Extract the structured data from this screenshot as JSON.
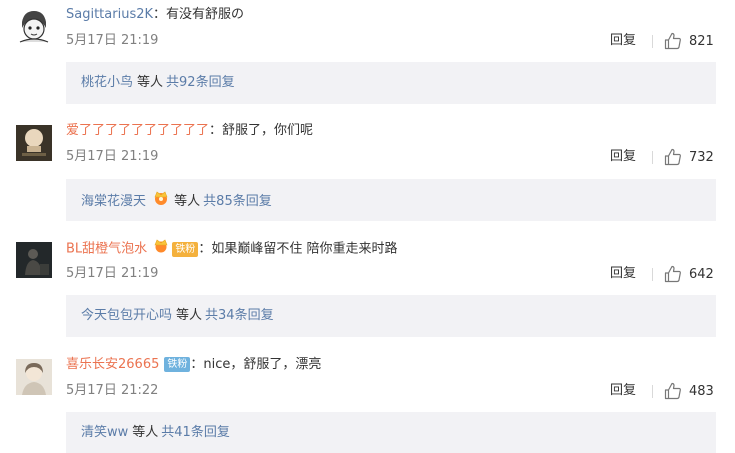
{
  "comments": [
    {
      "user": "Sagittarius2K",
      "colon": "：",
      "text": "有没有舒服の",
      "time": "5月17日 21:19",
      "reply_label": "回复",
      "likes": "821",
      "sub_name": "桃花小鸟",
      "sub_etc": "等人",
      "sub_total": "共92条回复"
    },
    {
      "user": "爱了了了了了了了了了了",
      "colon": "：",
      "text": "舒服了，你们呢",
      "time": "5月17日 21:19",
      "reply_label": "回复",
      "likes": "732",
      "sub_name": "海棠花漫天",
      "sub_etc": "等人",
      "sub_total": "共85条回复"
    },
    {
      "user": "BL甜橙气泡水",
      "fan_badge": "铁粉",
      "colon": "：",
      "text": "如果巅峰留不住 陪你重走来时路",
      "time": "5月17日 21:19",
      "reply_label": "回复",
      "likes": "642",
      "sub_name": "今天包包开心吗",
      "sub_etc": "等人",
      "sub_total": "共34条回复"
    },
    {
      "user": "喜乐长安26665",
      "fan_badge": "铁粉",
      "colon": "：",
      "text": "nice，舒服了，漂亮",
      "time": "5月17日 21:22",
      "reply_label": "回复",
      "likes": "483",
      "sub_name": "清笑ww",
      "sub_etc": "等人",
      "sub_total": "共41条回复"
    }
  ],
  "colors": {
    "username": "#eb7350",
    "link": "#5b7ca8",
    "meta": "#808080",
    "reply_bg": "#f2f2f5"
  }
}
